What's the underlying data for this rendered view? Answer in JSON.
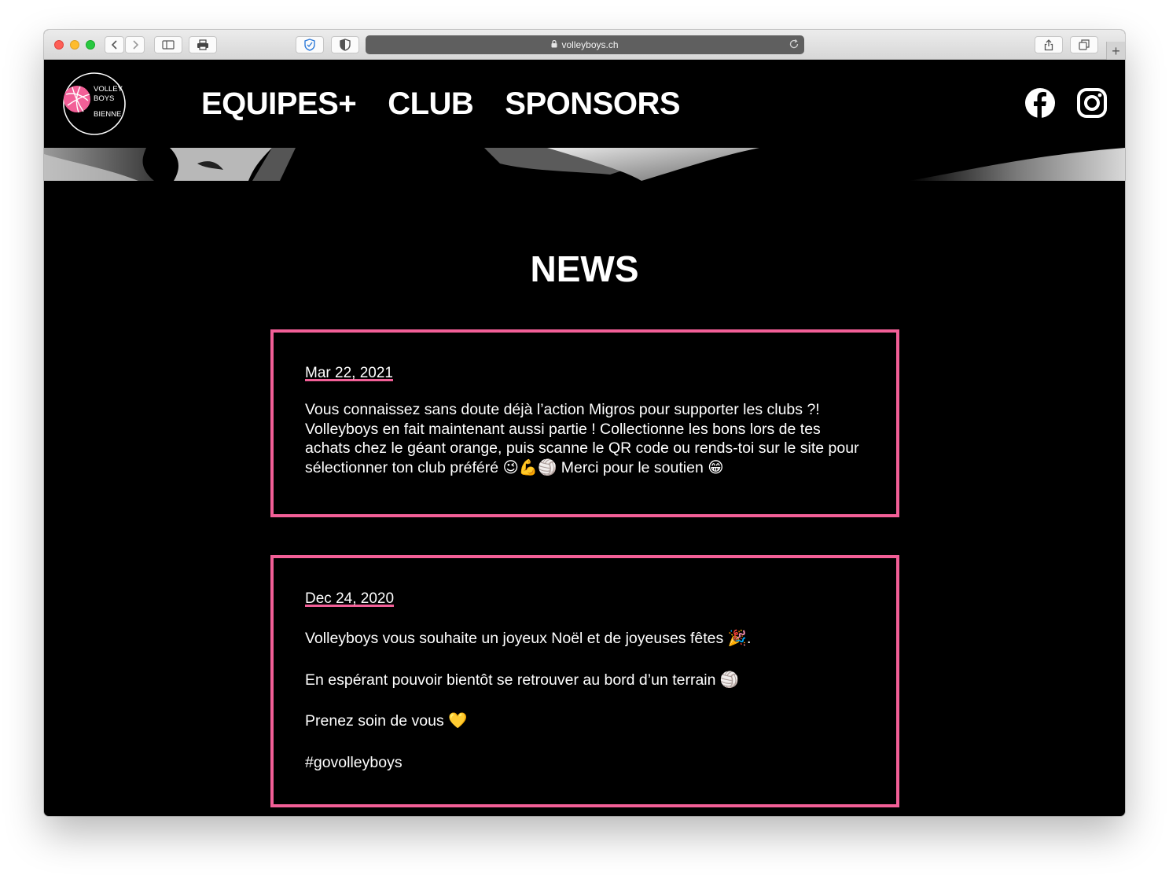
{
  "browser": {
    "url": "volleyboys.ch",
    "new_tab": "+"
  },
  "site": {
    "logo_text": [
      "VOLLEY",
      "BOYS",
      "BIENNE"
    ],
    "nav": [
      "EQUIPES+",
      "CLUB",
      "SPONSORS"
    ],
    "social": [
      "facebook-icon",
      "instagram-icon"
    ],
    "accent_color": "#f25f97"
  },
  "news": {
    "title": "NEWS",
    "posts": [
      {
        "date": "Mar 22, 2021",
        "paragraphs": [
          "Vous connaissez sans doute déjà l’action Migros pour supporter les clubs ?! Volleyboys en fait maintenant aussi partie ! Collectionne les bons lors de tes achats chez le géant orange, puis scanne le QR code ou rends-toi sur le site pour sélectionner ton club préféré 😉💪🏐 Merci pour le soutien 😁"
        ]
      },
      {
        "date": "Dec 24, 2020",
        "paragraphs": [
          "Volleyboys vous souhaite un joyeux Noël et de joyeuses fêtes 🎉.",
          "En espérant pouvoir bientôt se retrouver au bord d’un terrain 🏐",
          "Prenez soin de vous 💛",
          "#govolleyboys"
        ]
      }
    ]
  }
}
